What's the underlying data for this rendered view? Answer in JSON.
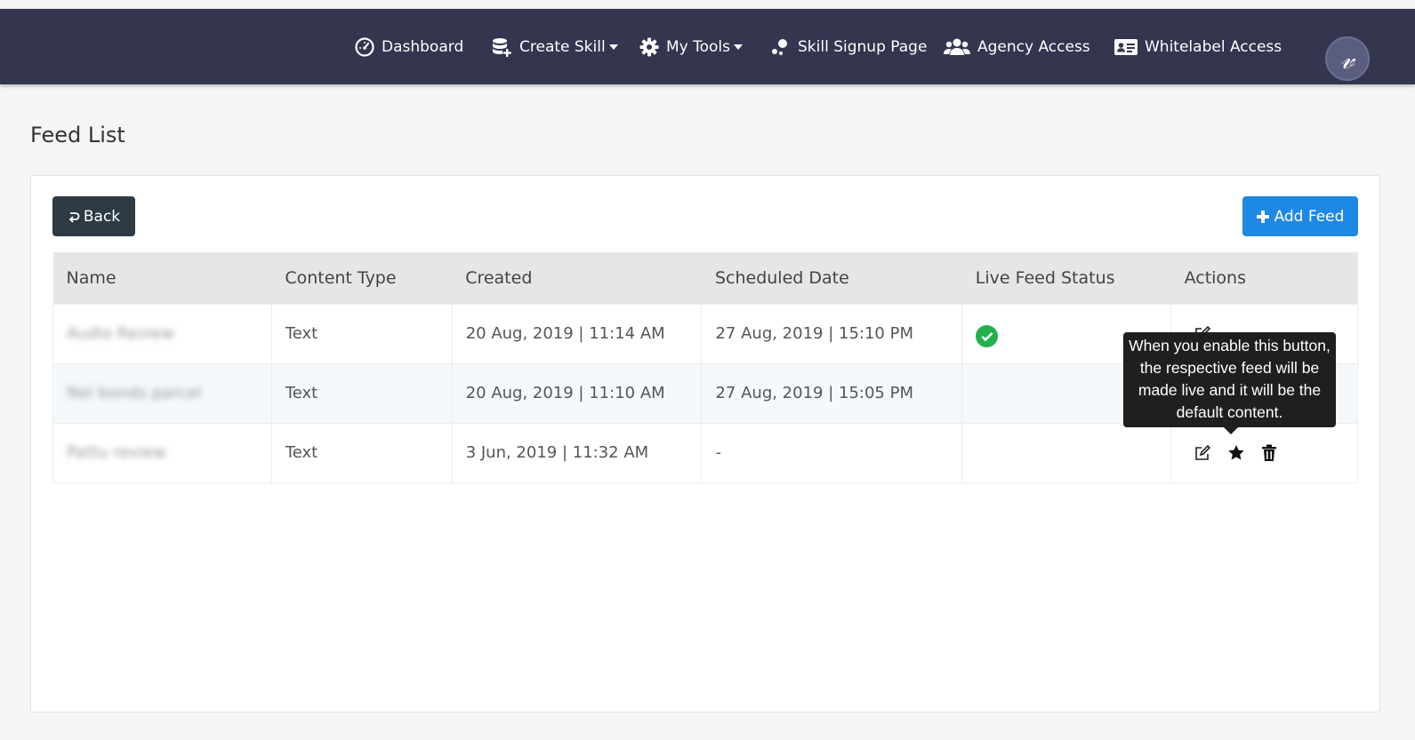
{
  "nav": {
    "items": [
      {
        "label": "Dashboard",
        "icon": "dashboard-icon",
        "dropdown": false
      },
      {
        "label": "Create Skill",
        "icon": "database-plus-icon",
        "dropdown": true
      },
      {
        "label": "My Tools",
        "icon": "gear-icon",
        "dropdown": true
      },
      {
        "label": "Skill Signup Page",
        "icon": "share-nodes-icon",
        "dropdown": false
      },
      {
        "label": "Agency Access",
        "icon": "users-icon",
        "dropdown": false
      },
      {
        "label": "Whitelabel Access",
        "icon": "id-card-icon",
        "dropdown": false
      }
    ],
    "avatar_letter": "𝓋"
  },
  "page": {
    "title": "Feed List",
    "back_label": "Back",
    "add_label": "Add Feed"
  },
  "table": {
    "headers": [
      "Name",
      "Content Type",
      "Created",
      "Scheduled Date",
      "Live Feed Status",
      "Actions"
    ],
    "rows": [
      {
        "name": "Audio Review",
        "type": "Text",
        "created": "20 Aug, 2019 | 11:14 AM",
        "scheduled": "27 Aug, 2019 | 15:10 PM",
        "live": true
      },
      {
        "name": "Nel bonds parcel",
        "type": "Text",
        "created": "20 Aug, 2019 | 11:10 AM",
        "scheduled": "27 Aug, 2019 | 15:05 PM",
        "live": false
      },
      {
        "name": "Pattu review",
        "type": "Text",
        "created": "3 Jun, 2019 | 11:32 AM",
        "scheduled": "-",
        "live": false
      }
    ]
  },
  "tooltip": {
    "lines": [
      "When you enable this button,",
      "the respective feed will be",
      "made live and it will be the",
      "default content."
    ]
  },
  "colors": {
    "navbar": "#34354f",
    "back_button": "#2e3a44",
    "add_button": "#1e88e5",
    "live_check": "#22b14c"
  }
}
